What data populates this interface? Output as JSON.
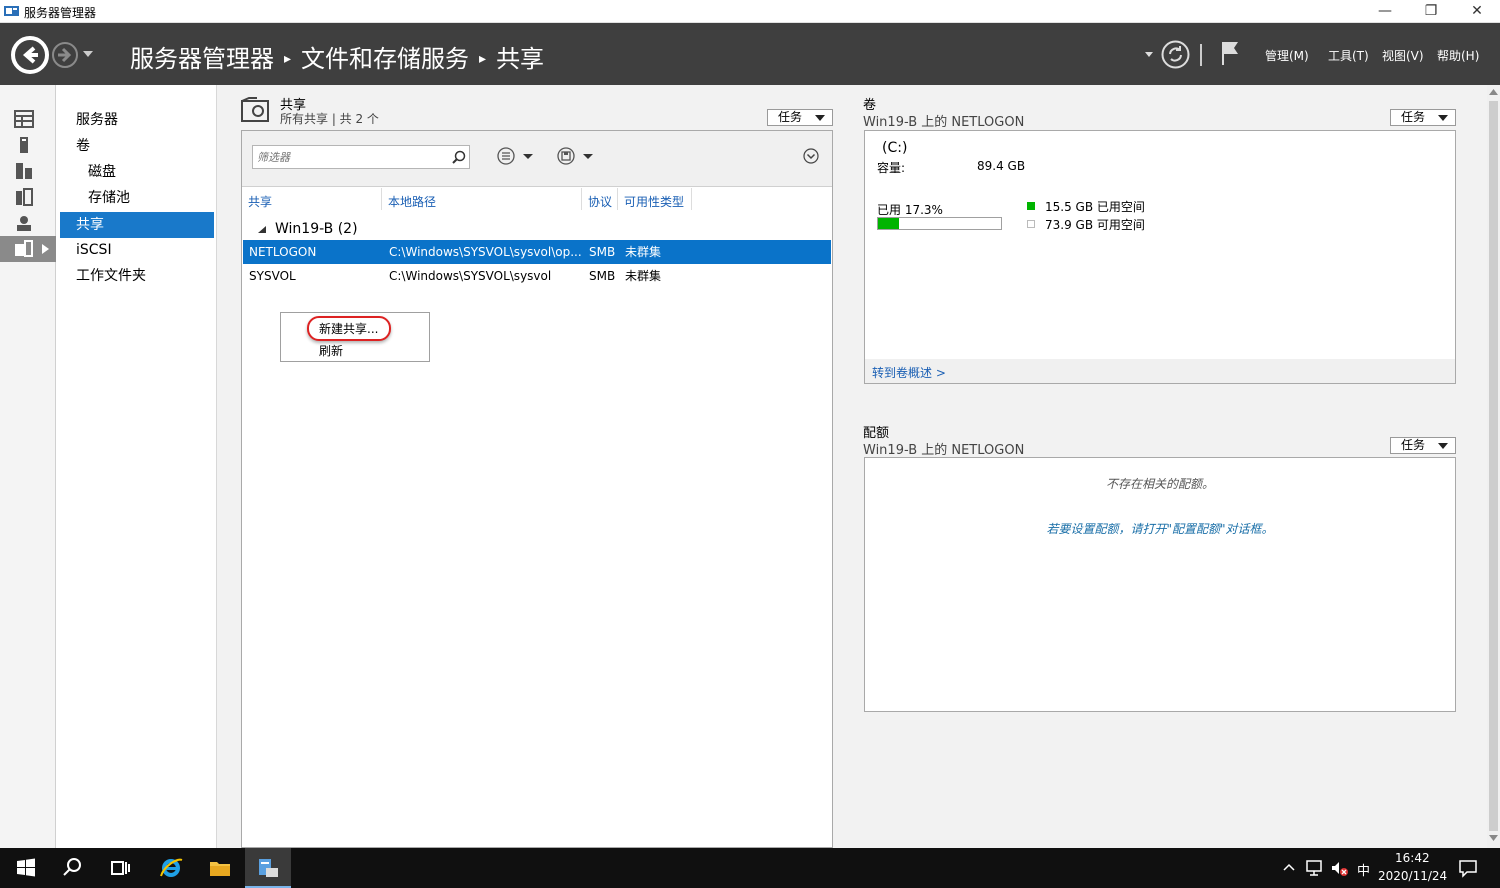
{
  "window": {
    "title": "服务器管理器",
    "min": "—",
    "restore": "❐",
    "close": "✕"
  },
  "breadcrumb": {
    "part1": "服务器管理器",
    "part2": "文件和存储服务",
    "part3": "共享",
    "sep": "▸"
  },
  "menus": {
    "manage": "管理(M)",
    "tools": "工具(T)",
    "view": "视图(V)",
    "help": "帮助(H)"
  },
  "nav": {
    "items": [
      {
        "label": "服务器"
      },
      {
        "label": "卷"
      },
      {
        "label": "磁盘"
      },
      {
        "label": "存储池"
      },
      {
        "label": "共享"
      },
      {
        "label": "iSCSI"
      },
      {
        "label": "工作文件夹"
      }
    ]
  },
  "shares": {
    "title": "共享",
    "subtitle": "所有共享 | 共 2 个",
    "task_label": "任务",
    "filter_placeholder": "筛选器",
    "columns": [
      "共享",
      "本地路径",
      "协议",
      "可用性类型"
    ],
    "group": "Win19-B (2)",
    "rows": [
      {
        "name": "NETLOGON",
        "path": "C:\\Windows\\SYSVOL\\sysvol\\op...",
        "protocol": "SMB",
        "availability": "未群集"
      },
      {
        "name": "SYSVOL",
        "path": "C:\\Windows\\SYSVOL\\sysvol",
        "protocol": "SMB",
        "availability": "未群集"
      }
    ]
  },
  "context_menu": {
    "new_share": "新建共享...",
    "refresh": "刷新"
  },
  "volume": {
    "title": "卷",
    "subtitle": "Win19-B 上的 NETLOGON",
    "task_label": "任务",
    "drive": "(C:)",
    "capacity_label": "容量:",
    "capacity": "89.4 GB",
    "used_pct_label": "已用 17.3%",
    "used_fraction": 0.173,
    "used": "15.5 GB 已用空间",
    "free": "73.9 GB 可用空间",
    "link": "转到卷概述 >",
    "used_color": "#00b400"
  },
  "quota": {
    "title": "配额",
    "subtitle": "Win19-B 上的 NETLOGON",
    "task_label": "任务",
    "empty": "不存在相关的配额。",
    "hint": "若要设置配额，请打开\"配置配额\"对话框。"
  },
  "taskbar": {
    "time": "16:42",
    "date": "2020/11/24",
    "ime": "中"
  },
  "colors": {
    "accent": "#1979ca",
    "selected_row": "#0a73c9",
    "navbar": "#3f3f3f"
  }
}
